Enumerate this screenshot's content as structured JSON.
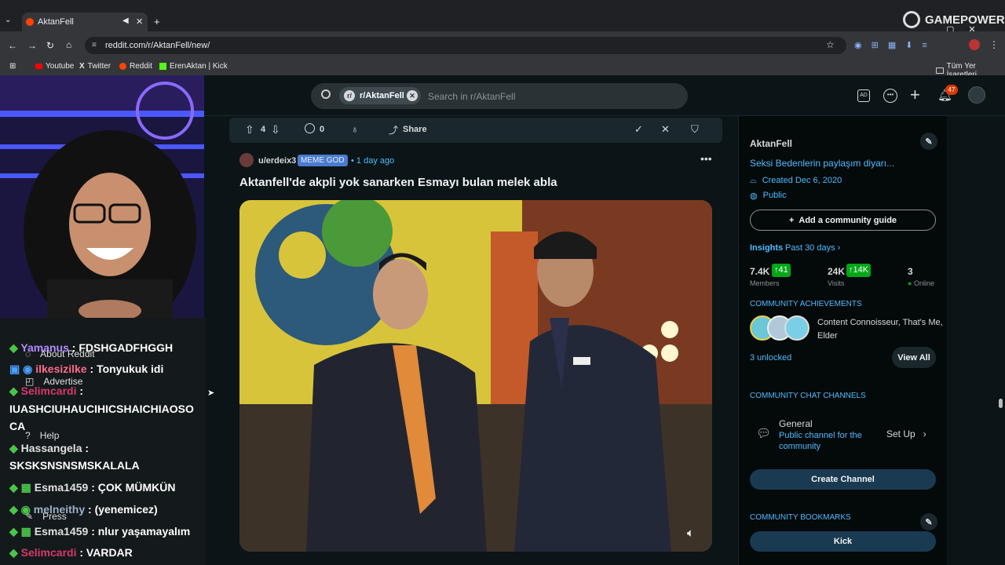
{
  "browser": {
    "tab_title": "AktanFell",
    "url": "reddit.com/r/AktanFell/new/",
    "bookmarks": [
      "Youtube",
      "Twitter",
      "Reddit",
      "ErenAktan | Kick"
    ],
    "all_bookmarks": "Tüm Yer İşaretleri"
  },
  "overlay": {
    "brand": "GAMEPOWER"
  },
  "header": {
    "community_chip": "r/AktanFell",
    "search_placeholder": "Search in r/AktanFell",
    "notif_count": "47"
  },
  "post": {
    "votes": "4",
    "comments": "0",
    "share_label": "Share",
    "author": "u/erdeix3",
    "flair": "MEME GOD",
    "time": "1 day ago",
    "title": "Aktanfell'de akpli yok sanarken Esmayı bulan melek abla"
  },
  "left_menu": [
    "About Reddit",
    "Advertise",
    "Help",
    "Press"
  ],
  "chat": [
    {
      "user": "Yamanus",
      "msg": ": FDSHGADFHGGH",
      "color": "#b38cff"
    },
    {
      "user": "ilkesizilke",
      "msg": ": Tonyukuk idi",
      "color": "#ff6b8a"
    },
    {
      "user": "Selimcardi",
      "msg": ":",
      "color": "#d63a6a"
    },
    {
      "user": "",
      "msg": "IUASHCIUHAUCIHICSHAICHIAOSO",
      "color": "#fff"
    },
    {
      "user": "",
      "msg": "CA",
      "color": "#fff"
    },
    {
      "user": "Hassangela",
      "msg": ":",
      "color": "#e0e0e0"
    },
    {
      "user": "",
      "msg": "SKSKSNSNSMSKALALA",
      "color": "#fff"
    },
    {
      "user": "Esma1459",
      "msg": ": ÇOK MÜMKÜN",
      "color": "#e0e0e0"
    },
    {
      "user": "melneithy",
      "msg": ": (yenemicez)",
      "color": "#9bb0c8"
    },
    {
      "user": "Esma1459",
      "msg": ": nlur yaşamayalım",
      "color": "#e0e0e0"
    },
    {
      "user": "Selimcardi",
      "msg": ": VARDAR",
      "color": "#d63a6a"
    }
  ],
  "sidebar": {
    "name": "AktanFell",
    "description": "Seksi Bedenlerin paylaşım diyarı...",
    "created": "Created Dec 6, 2020",
    "visibility": "Public",
    "add_guide": "Add a community guide",
    "insights": "Insights",
    "insights_period": "Past 30 days",
    "members_value": "7.4K",
    "members_delta": "41",
    "members_label": "Members",
    "visits_value": "24K",
    "visits_delta": "14K",
    "visits_label": "Visits",
    "online_value": "3",
    "online_label": "Online",
    "achievements_title": "COMMUNITY ACHIEVEMENTS",
    "achievements_text": "Content Connoisseur, That's Me, Elder",
    "unlocked": "3 unlocked",
    "view_all": "View All",
    "chat_title": "COMMUNITY CHAT CHANNELS",
    "channel_name": "General",
    "channel_desc": "Public channel for the community",
    "set_up": "Set Up",
    "create_channel": "Create Channel",
    "bookmarks_title": "COMMUNITY BOOKMARKS",
    "bookmark_kick": "Kick"
  }
}
